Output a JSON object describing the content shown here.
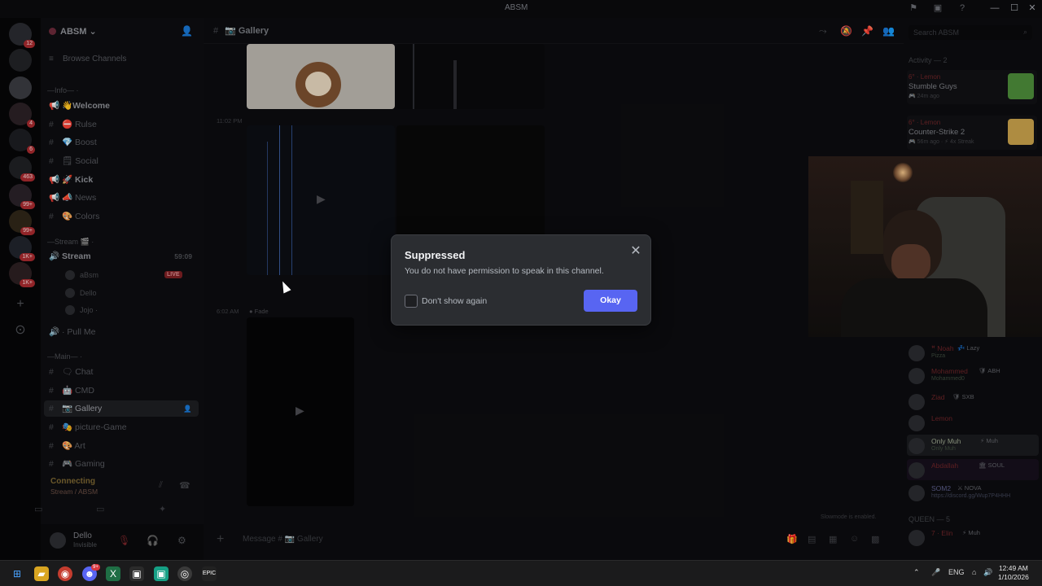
{
  "window": {
    "title": "ABSM"
  },
  "server": {
    "name": "ABSM",
    "browse_label": "Browse Channels"
  },
  "rail": {
    "badges": [
      "12",
      "4",
      "6",
      "463",
      "99+",
      "99+",
      "1K+",
      "1K+"
    ]
  },
  "sidebar": {
    "cat_info": "—Info— ·",
    "channels_info": [
      {
        "icon": "📢",
        "label": "👋Welcome",
        "bold": true
      },
      {
        "icon": "#",
        "label": "⛔ Rulse",
        "bold": false
      },
      {
        "icon": "#",
        "label": "💎 Boost",
        "bold": false
      },
      {
        "icon": "#",
        "label": "🗒 Social",
        "bold": false
      },
      {
        "icon": "📢",
        "label": "🚀 Kick",
        "bold": true
      },
      {
        "icon": "📢",
        "label": "📣 News",
        "bold": false
      },
      {
        "icon": "#",
        "label": "🎨 Colors",
        "bold": false
      }
    ],
    "cat_stream": "—Stream 🎬 ·",
    "stream_channel": {
      "label": "Stream",
      "time": "59:09"
    },
    "voice_users": [
      {
        "name": "aBsm",
        "live": "LIVE"
      },
      {
        "name": "Dello",
        "live": ""
      },
      {
        "name": "Jojo ·",
        "live": ""
      }
    ],
    "pull_me": "· Pull Me",
    "cat_main": "—Main— ·",
    "channels_main": [
      {
        "label": "🗨 Chat",
        "active": false
      },
      {
        "label": "🤖 CMD",
        "active": false
      },
      {
        "label": "📷 Gallery",
        "active": true
      },
      {
        "label": "🎭 picture-Game",
        "active": false
      },
      {
        "label": "🎨 Art",
        "active": false
      },
      {
        "label": "🎮 Gaming",
        "active": false
      }
    ],
    "voice_status": "Connecting",
    "voice_location": "Stream / ABSM",
    "user": {
      "name": "Dello",
      "status": "Invisible"
    }
  },
  "main": {
    "channel_title": "📷 Gallery",
    "timestamp1": "11:02 PM",
    "timestamp2": "6:02 AM",
    "author2": "● Fade",
    "input_placeholder": "Message # 📷 Gallery",
    "slowmode": "Slowmode is enabled."
  },
  "members": {
    "search_placeholder": "Search ABSM",
    "activity_header": "Activity — 2",
    "activities": [
      {
        "name": "6° · Lemon",
        "game": "Stumble Guys",
        "sub": "🎮 24m ago",
        "color": "#4c8a3a"
      },
      {
        "name": "6° · Lemon",
        "game": "Counter-Strike 2",
        "sub": "🎮 56m ago · ⚡ 4x Streak",
        "color": "#c7a04a"
      }
    ],
    "list": [
      {
        "name": "ꟸ Noah",
        "tag": "💤 Lazy",
        "sub": "Pizza"
      },
      {
        "name": "Mohammed",
        "tag": "🛡 ABH",
        "sub": "Mohammed0"
      },
      {
        "name": "Ziad",
        "tag": "🛡 SXB",
        "sub": ""
      },
      {
        "name": "Lemon",
        "tag": "",
        "sub": ""
      },
      {
        "name": "Only Muh",
        "tag": "⚡ Muh",
        "sub": "Only Muh"
      },
      {
        "name": "Abdallah",
        "tag": "🏛 SOUL",
        "sub": ""
      },
      {
        "name": "SOM2",
        "tag": "⚔ NOVA",
        "sub": "https://discord.gg/Wup7P4HHH"
      }
    ],
    "queen_header": "QUEEN — 5",
    "queen_first": {
      "name": "7 · Elin",
      "tag": "⚡ Muh"
    }
  },
  "modal": {
    "title": "Suppressed",
    "body": "You do not have permission to speak in this channel.",
    "checkbox_label": "Don't show again",
    "ok_label": "Okay"
  },
  "taskbar": {
    "lang": "ENG",
    "time": "12:49 AM",
    "date": "1/10/2026",
    "discord_badge": "9+"
  }
}
